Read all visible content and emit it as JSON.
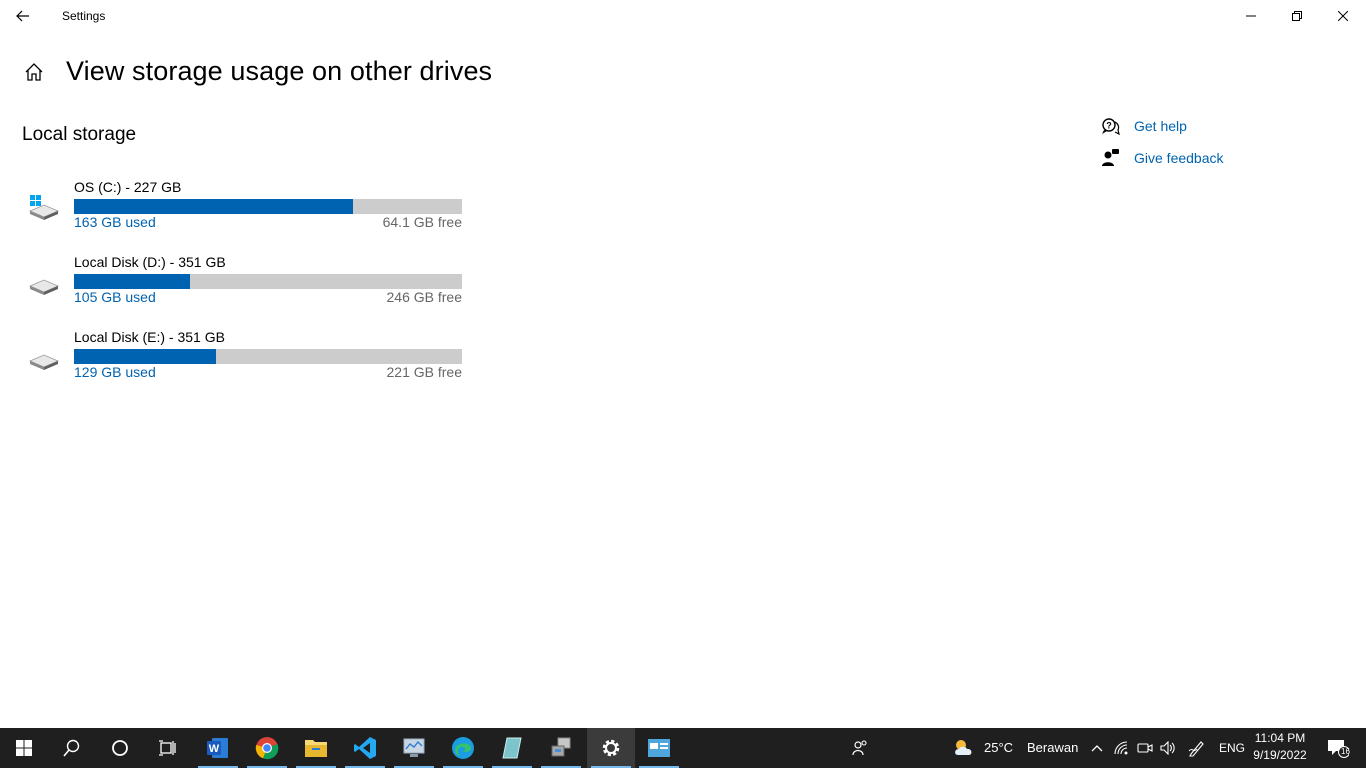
{
  "window": {
    "title": "Settings",
    "back_icon": "arrow-left-icon",
    "minimize_icon": "minimize-icon",
    "restore_icon": "restore-icon",
    "close_icon": "close-icon"
  },
  "header": {
    "home_icon": "home-icon",
    "title": "View storage usage on other drives"
  },
  "section": {
    "title": "Local storage"
  },
  "drives": [
    {
      "name": "OS (C:) - 227 GB",
      "used_label": "163 GB used",
      "free_label": "64.1 GB free",
      "used_fraction": 0.718,
      "icon": "windows-drive-icon"
    },
    {
      "name": "Local Disk (D:) - 351 GB",
      "used_label": "105 GB used",
      "free_label": "246 GB free",
      "used_fraction": 0.299,
      "icon": "hard-drive-icon"
    },
    {
      "name": "Local Disk (E:) - 351 GB",
      "used_label": "129 GB used",
      "free_label": "221 GB free",
      "used_fraction": 0.367,
      "icon": "hard-drive-icon"
    }
  ],
  "side_links": {
    "help": {
      "label": "Get help",
      "icon": "help-chat-icon"
    },
    "feedback": {
      "label": "Give feedback",
      "icon": "feedback-person-icon"
    }
  },
  "taskbar": {
    "weather_temp": "25°C",
    "weather_desc": "Berawan",
    "language": "ENG",
    "time": "11:04 PM",
    "date": "9/19/2022",
    "notification_count": "16"
  },
  "colors": {
    "accent": "#0063b1",
    "bar_track": "#cccccc",
    "taskbar": "#1f1f1f"
  }
}
